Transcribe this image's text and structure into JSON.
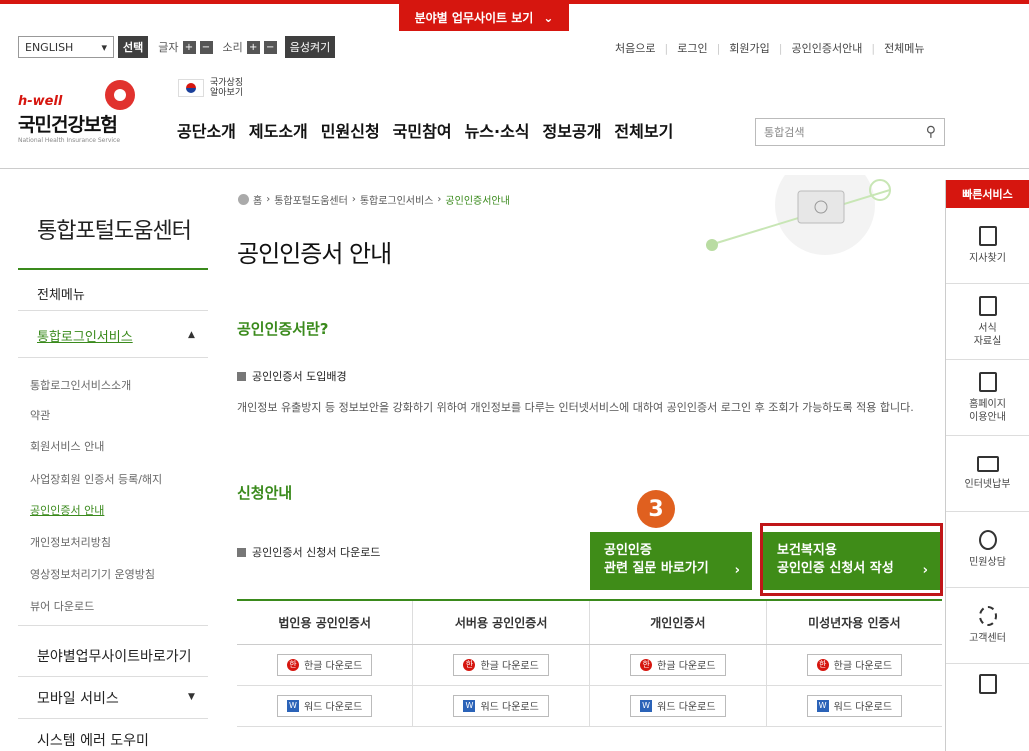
{
  "top": {
    "field_tab": "분야별 업무사이트 보기",
    "lang_select": "ENGLISH",
    "select_btn": "선택",
    "font_label": "글자",
    "sound_label": "소리",
    "voice_btn": "음성켜기",
    "links": [
      "처음으로",
      "로그인",
      "회원가입",
      "공인인증서안내",
      "전체메뉴"
    ]
  },
  "header": {
    "logo_hwell": "h-well",
    "logo_kr": "국민건강보험",
    "logo_en": "National Health Insurance Service",
    "flag_text_1": "국가상징",
    "flag_text_2": "알아보기",
    "gnb": [
      "공단소개",
      "제도소개",
      "민원신청",
      "국민참여",
      "뉴스·소식",
      "정보공개",
      "전체보기"
    ],
    "search_placeholder": "통합검색"
  },
  "lnb": {
    "title": "통합포털도움센터",
    "all_menu": "전체메뉴",
    "section": "통합로그인서비스",
    "subs": [
      "통합로그인서비스소개",
      "약관",
      "회원서비스 안내",
      "사업장회원 인증서 등록/해지",
      "공인인증서 안내",
      "개인정보처리방침",
      "영상정보처리기기 운영방침",
      "뷰어 다운로드"
    ],
    "bottom": [
      "분야별업무사이트바로가기",
      "모바일 서비스",
      "시스템 에러 도우미"
    ]
  },
  "content": {
    "breadcrumb": [
      "홈",
      "통합포털도움센터",
      "통합로그인서비스",
      "공인인증서안내"
    ],
    "title": "공인인증서 안내",
    "h_what": "공인인증서란?",
    "bullet_bg": "공인인증서 도입배경",
    "para": "개인정보 유출방지 등 정보보안을 강화하기 위하여 개인정보를 다루는 인터넷서비스에 대하여 공인인증서 로그인 후 조회가 가능하도록 적용 합니다.",
    "h_apply": "신청안내",
    "bullet_download": "공인인증서 신청서 다운로드",
    "step_number": "3",
    "btn_faq_1": "공인인증",
    "btn_faq_2": "관련 질문 바로가기",
    "btn_apply_1": "보건복지용",
    "btn_apply_2": "공인인증 신청서 작성",
    "table_headers": [
      "법인용 공인인증서",
      "서버용 공인인증서",
      "개인인증서",
      "미성년자용 인증서"
    ],
    "hangul_download": "한글 다운로드",
    "word_download": "워드 다운로드"
  },
  "quick": {
    "header": "빠른서비스",
    "items": [
      "지사찾기",
      "서식\n자료실",
      "홈페이지\n이용안내",
      "인터넷납부",
      "민원상담",
      "고객센터"
    ]
  },
  "colors": {
    "brand_red": "#d6160f",
    "brand_green": "#3a8a1c",
    "step_orange": "#e0601f"
  }
}
